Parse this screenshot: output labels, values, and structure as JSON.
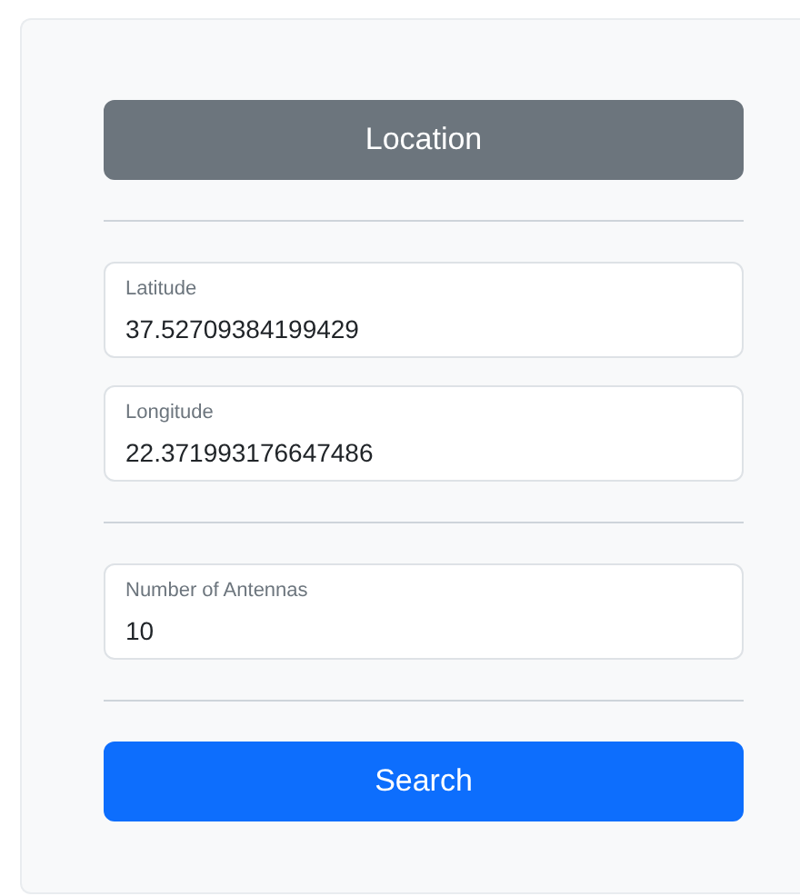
{
  "items": [
    {
      "kind": "button",
      "label": "Location"
    },
    {
      "kind": "divider"
    },
    {
      "kind": "field",
      "label": "Latitude",
      "value": "37.52709384199429"
    },
    {
      "kind": "field",
      "label": "Longitude",
      "value": "22.371993176647486"
    },
    {
      "kind": "divider"
    },
    {
      "kind": "field",
      "label": "Number of Antennas",
      "value": "10"
    },
    {
      "kind": "divider"
    },
    {
      "kind": "button",
      "label": "Search"
    }
  ]
}
